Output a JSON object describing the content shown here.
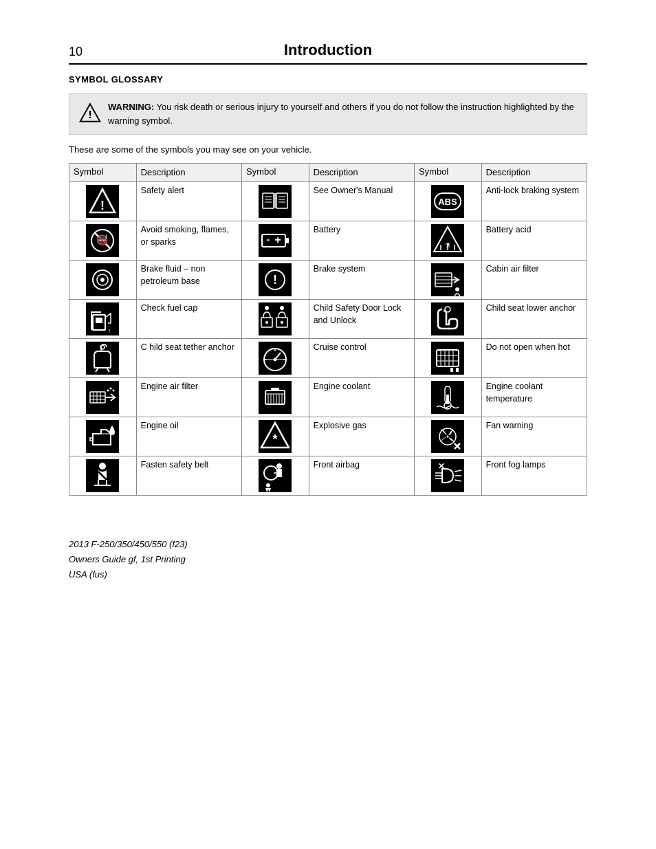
{
  "page": {
    "number": "10",
    "title": "Introduction",
    "section_title": "SYMBOL GLOSSARY",
    "warning_label": "WARNING:",
    "warning_text": " You risk death or serious injury to yourself and others if you do not follow the instruction highlighted by the warning symbol.",
    "intro_text": "These are some of the symbols you may see on your vehicle.",
    "columns": [
      "Symbol",
      "Description",
      "Symbol",
      "Description",
      "Symbol",
      "Description"
    ],
    "rows": [
      {
        "sym1": "safety-alert-icon",
        "desc1": "Safety alert",
        "sym2": "owners-manual-icon",
        "desc2": "See Owner's Manual",
        "sym3": "abs-icon",
        "desc3": "Anti-lock braking system"
      },
      {
        "sym1": "no-smoking-icon",
        "desc1": "Avoid smoking, flames, or sparks",
        "sym2": "battery-icon",
        "desc2": "Battery",
        "sym3": "battery-acid-icon",
        "desc3": "Battery acid"
      },
      {
        "sym1": "brake-fluid-icon",
        "desc1": "Brake fluid – non petroleum base",
        "sym2": "brake-system-icon",
        "desc2": "Brake system",
        "sym3": "cabin-air-filter-icon",
        "desc3": "Cabin air filter"
      },
      {
        "sym1": "check-fuel-cap-icon",
        "desc1": "Check fuel cap",
        "sym2": "child-safety-door-icon",
        "desc2": "Child Safety Door Lock and Unlock",
        "sym3": "child-seat-lower-anchor-icon",
        "desc3": "Child seat lower anchor"
      },
      {
        "sym1": "child-seat-tether-icon",
        "desc1": "C hild seat tether anchor",
        "sym2": "cruise-control-icon",
        "desc2": "Cruise control",
        "sym3": "do-not-open-hot-icon",
        "desc3": "Do not open when hot"
      },
      {
        "sym1": "engine-air-filter-icon",
        "desc1": "Engine air filter",
        "sym2": "engine-coolant-icon",
        "desc2": "Engine coolant",
        "sym3": "engine-coolant-temp-icon",
        "desc3": "Engine coolant temperature"
      },
      {
        "sym1": "engine-oil-icon",
        "desc1": "Engine oil",
        "sym2": "explosive-gas-icon",
        "desc2": "Explosive gas",
        "sym3": "fan-warning-icon",
        "desc3": "Fan warning"
      },
      {
        "sym1": "fasten-seatbelt-icon",
        "desc1": "Fasten safety belt",
        "sym2": "front-airbag-icon",
        "desc2": "Front airbag",
        "sym3": "front-fog-lamps-icon",
        "desc3": "Front fog lamps"
      }
    ],
    "footer": {
      "line1": "2013 F-250/350/450/550 (f23)",
      "line2": "Owners Guide gf, 1st Printing",
      "line3": "USA (fus)"
    }
  }
}
